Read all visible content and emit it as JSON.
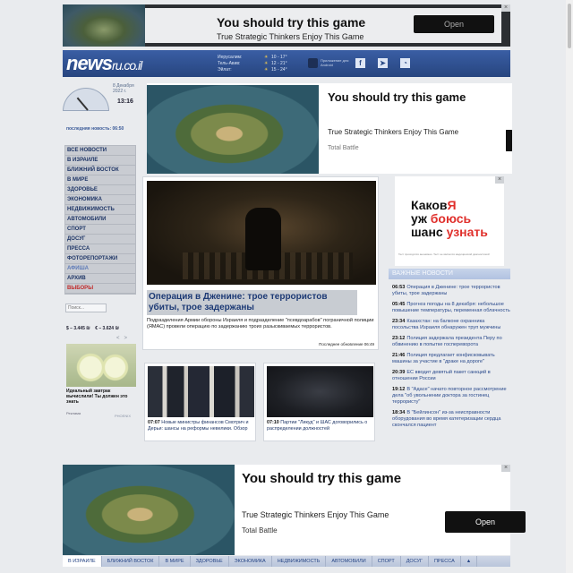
{
  "top_ad": {
    "title": "You should try this game",
    "subtitle": "True Strategic Thinkers Enjoy This Game",
    "button": "Open"
  },
  "header": {
    "logo_main": "news",
    "logo_suffix": "ru.co.il",
    "weather": [
      {
        "city": "Иерусалим:",
        "temp": "10 - 17°"
      },
      {
        "city": "Тель-Авив:",
        "temp": "12 - 21°"
      },
      {
        "city": "Эйлат:",
        "temp": "15 - 24°"
      }
    ],
    "app_text": "Приложение для Android"
  },
  "sidebar": {
    "date": "8 Декабря 2022 г.",
    "time": "13:16",
    "last_news": "последняя новость: 06:50",
    "menu": [
      "ВСЕ НОВОСТИ",
      "В ИЗРАИЛЕ",
      "БЛИЖНИЙ ВОСТОК",
      "В МИРЕ",
      "ЗДОРОВЬЕ",
      "ЭКОНОМИКА",
      "НЕДВИЖИМОСТЬ",
      "АВТОМОБИЛИ",
      "СПОРТ",
      "ДОСУГ",
      "ПРЕССА",
      "ФОТОРЕПОРТАЖИ",
      "АФИША",
      "АРХИВ",
      "ВЫБОРЫ"
    ],
    "search_placeholder": "Поиск...",
    "rates": "$ – 3.445 ₪    € – 3.624 ₪",
    "rate_arrows": "<   >",
    "ad_text": "Идеальный завтрак вычислили! Ты должен это знать",
    "ad_source": "Реклама",
    "ad_phoenix": "PHOENIX"
  },
  "mid_ad": {
    "title": "You should try this game",
    "subtitle": "True Strategic Thinkers Enjoy This Game",
    "source": "Total Battle"
  },
  "main_article": {
    "title": "Операция в Дженине: трое террористов убиты, трое задержаны",
    "text": "Подразделения Армии обороны Израиля и подразделение \"псевдоарабов\" пограничной полиции (ЯМАС) провели операцию по задержанию троих разыскиваемых террористов.",
    "updated": "Последнее обновление 06:49"
  },
  "small_articles": [
    {
      "time": "07:07",
      "text": "Новые министры финансов Смотрич и Дерьи: шансы на реформы невелики. Обзор"
    },
    {
      "time": "07:10",
      "text": "Партии \"Ликуд\" и ШАС договорились о распределении должностей"
    }
  ],
  "right_ad": {
    "line1a": "Каков",
    "line1b": "Я",
    "line2a": "уж",
    "line2b": "боюсь",
    "line3a": "шанс",
    "line3b": "узнать",
    "footer": "Тест проходится анонимно. Тест не является медицинской диагностикой"
  },
  "important_news": {
    "header": "ВАЖНЫЕ НОВОСТИ",
    "items": [
      {
        "time": "06:53",
        "text": "Операция в Дженине: трое террористов убиты, трое задержаны"
      },
      {
        "time": "05:45",
        "text": "Прогноз погоды на 8 декабря: небольшое повышение температуры, переменная облачность"
      },
      {
        "time": "23:34",
        "text": "Казахстан: на балконе охранника посольства Израиля обнаружен труп мужчины"
      },
      {
        "time": "23:12",
        "text": "Полиция задержала президента Перу по обвинению в попытке госпереворота"
      },
      {
        "time": "21:46",
        "text": "Полиция предлагает конфисковывать машины за участие в \"драке на дороге\""
      },
      {
        "time": "20:39",
        "text": "ЕС вводит девятый пакет санкций в отношении России"
      },
      {
        "time": "19:12",
        "text": "В \"Адасе\" начато повторное рассмотрение дела \"об увольнении доктора за гостинец террористу\""
      },
      {
        "time": "18:34",
        "text": "В \"Бейлинсон\" из-за неисправности оборудования во время катетеризации сердца скончался пациент"
      }
    ]
  },
  "bottom_ad": {
    "title": "You should try this game",
    "subtitle": "True Strategic Thinkers Enjoy This Game",
    "source": "Total Battle",
    "button": "Open"
  },
  "bottom_nav": [
    "В ИЗРАИЛЕ",
    "БЛИЖНИЙ ВОСТОК",
    "В МИРЕ",
    "ЗДОРОВЬЕ",
    "ЭКОНОМИКА",
    "НЕДВИЖИМОСТЬ",
    "АВТОМОБИЛИ",
    "СПОРТ",
    "ДОСУГ",
    "ПРЕССА"
  ]
}
